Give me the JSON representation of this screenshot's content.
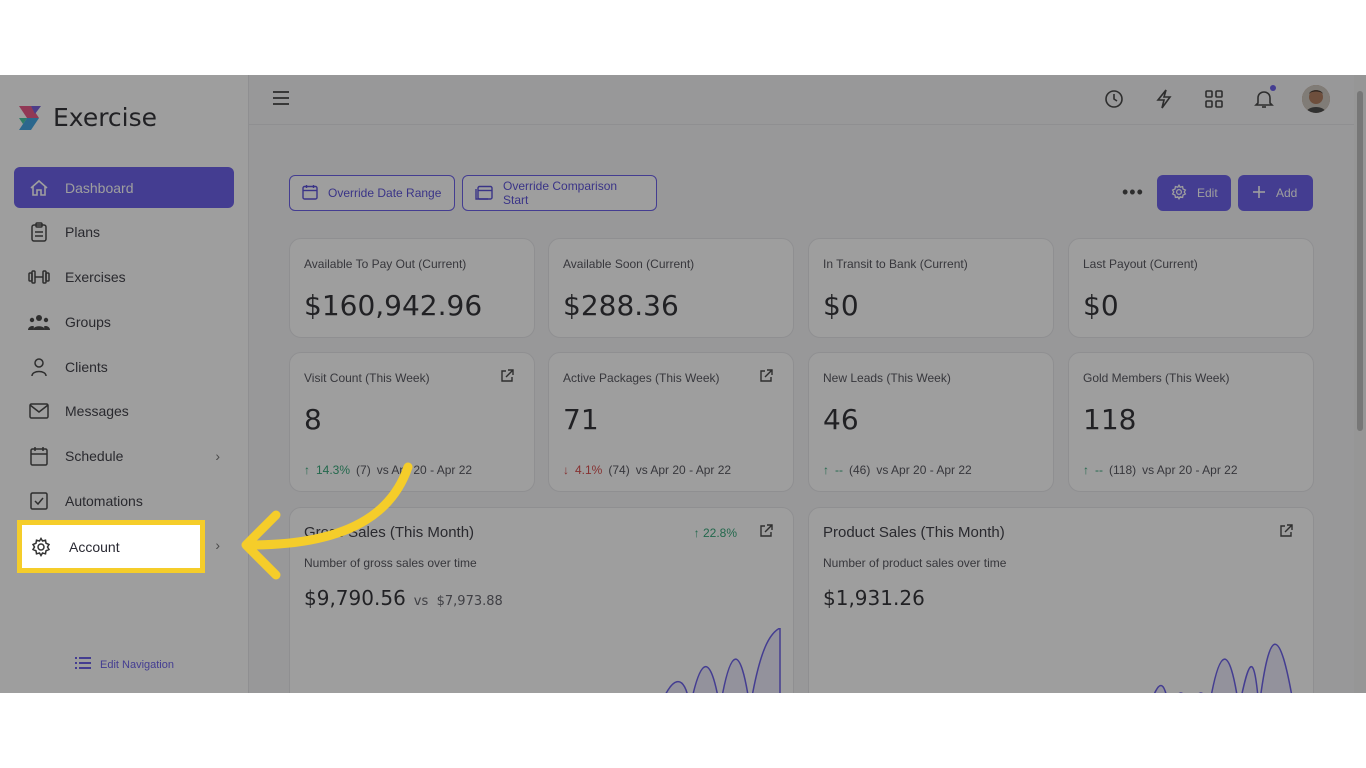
{
  "app": {
    "name": "Exercise"
  },
  "sidebar": {
    "items": [
      {
        "label": "Dashboard",
        "icon": "home-icon",
        "active": true
      },
      {
        "label": "Plans",
        "icon": "clipboard-icon"
      },
      {
        "label": "Exercises",
        "icon": "dumbbell-icon"
      },
      {
        "label": "Groups",
        "icon": "group-icon"
      },
      {
        "label": "Clients",
        "icon": "user-icon"
      },
      {
        "label": "Messages",
        "icon": "mail-icon"
      },
      {
        "label": "Schedule",
        "icon": "calendar-icon",
        "has_submenu": true
      },
      {
        "label": "Automations",
        "icon": "checkbox-icon"
      },
      {
        "label": "Account",
        "icon": "gear-icon",
        "has_submenu": true,
        "highlighted": true
      }
    ],
    "edit_navigation": "Edit Navigation"
  },
  "toolbar": {
    "override_date_range": "Override Date Range",
    "override_comparison_start": "Override Comparison Start",
    "more": "•••",
    "edit": "Edit",
    "add": "Add"
  },
  "stat_cards": [
    {
      "label": "Available To Pay Out (Current)",
      "value": "$160,942.96"
    },
    {
      "label": "Available Soon (Current)",
      "value": "$288.36"
    },
    {
      "label": "In Transit to Bank (Current)",
      "value": "$0"
    },
    {
      "label": "Last Payout (Current)",
      "value": "$0"
    }
  ],
  "week_cards": [
    {
      "label": "Visit Count (This Week)",
      "value": "8",
      "delta_pct": "14.3%",
      "delta_count": "(7)",
      "compare": "vs Apr 20 - Apr 22",
      "direction": "up",
      "external": true
    },
    {
      "label": "Active Packages (This Week)",
      "value": "71",
      "delta_pct": "4.1%",
      "delta_count": "(74)",
      "compare": "vs Apr 20 - Apr 22",
      "direction": "down",
      "external": true
    },
    {
      "label": "New Leads (This Week)",
      "value": "46",
      "delta_pct": "--",
      "delta_count": "(46)",
      "compare": "vs Apr 20 - Apr 22",
      "direction": "up",
      "external": false
    },
    {
      "label": "Gold Members (This Week)",
      "value": "118",
      "delta_pct": "--",
      "delta_count": "(118)",
      "compare": "vs Apr 20 - Apr 22",
      "direction": "up",
      "external": false
    }
  ],
  "gross_sales": {
    "title": "Gross Sales (This Month)",
    "subtitle": "Number of gross sales over time",
    "amount": "$9,790.56",
    "vs_label": "vs",
    "vs_amount": "$7,973.88",
    "delta_pct": "22.8%"
  },
  "product_sales": {
    "title": "Product Sales (This Month)",
    "subtitle": "Number of product sales over time",
    "amount": "$1,931.26"
  },
  "colors": {
    "accent": "#5b4fe8",
    "highlight": "#f5cd2a",
    "up": "#1f9d6b",
    "down": "#d33a3a"
  }
}
